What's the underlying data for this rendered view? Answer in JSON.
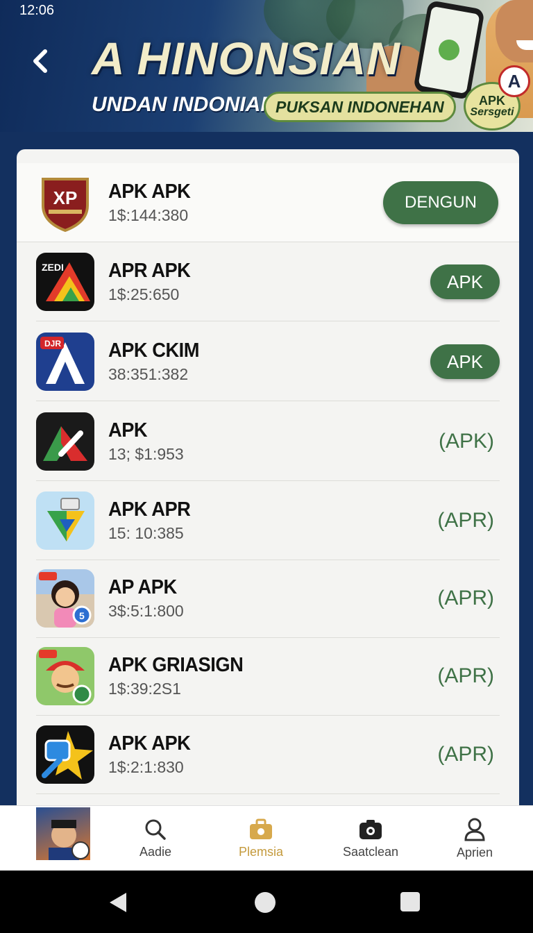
{
  "status_bar": {
    "time": "12:06"
  },
  "banner": {
    "title": "A HINONSIAN",
    "subtitle": "UNDAN INDONIAN",
    "pill": "PUKSAN INDONEHAN",
    "badge_line1": "APK",
    "badge_line2": "Sersgeti",
    "badge_letter": "A"
  },
  "apps": [
    {
      "name": "APK APK",
      "meta": "1$:144:380",
      "action": "DENGUN",
      "icon": "shield-logo-icon"
    },
    {
      "name": "APR APK",
      "meta": "1$:25:650",
      "action": "APK",
      "icon": "triangle-logo-icon"
    },
    {
      "name": "APK CKIM",
      "meta": "38:351:382",
      "action": "APK",
      "icon": "letter-a-logo-icon"
    },
    {
      "name": "APK",
      "meta": "13; $1:953",
      "action": "(APK)",
      "icon": "red-green-a-logo-icon"
    },
    {
      "name": "APK APR",
      "meta": "15: 10:385",
      "action": "(APR)",
      "icon": "play-store-logo-icon"
    },
    {
      "name": "AP  APK",
      "meta": "3$:5:1:800",
      "action": "(APR)",
      "icon": "cartoon-girl-icon"
    },
    {
      "name": "APK GRIASIGN",
      "meta": "1$:39:2S1",
      "action": "(APR)",
      "icon": "cartoon-boy-icon"
    },
    {
      "name": "APK APK",
      "meta": "1$:2:1:830",
      "action": "(APR)",
      "icon": "star-logo-icon"
    }
  ],
  "bottom_nav": [
    {
      "label": "Aadie",
      "icon": "search-icon"
    },
    {
      "label": "Plemsia",
      "icon": "briefcase-icon"
    },
    {
      "label": "Saatclean",
      "icon": "camera-icon"
    },
    {
      "label": "Aprien",
      "icon": "person-icon"
    }
  ],
  "colors": {
    "primary_green": "#3f7247",
    "header_navy": "#13305f",
    "active_nav": "#c49a3c"
  }
}
